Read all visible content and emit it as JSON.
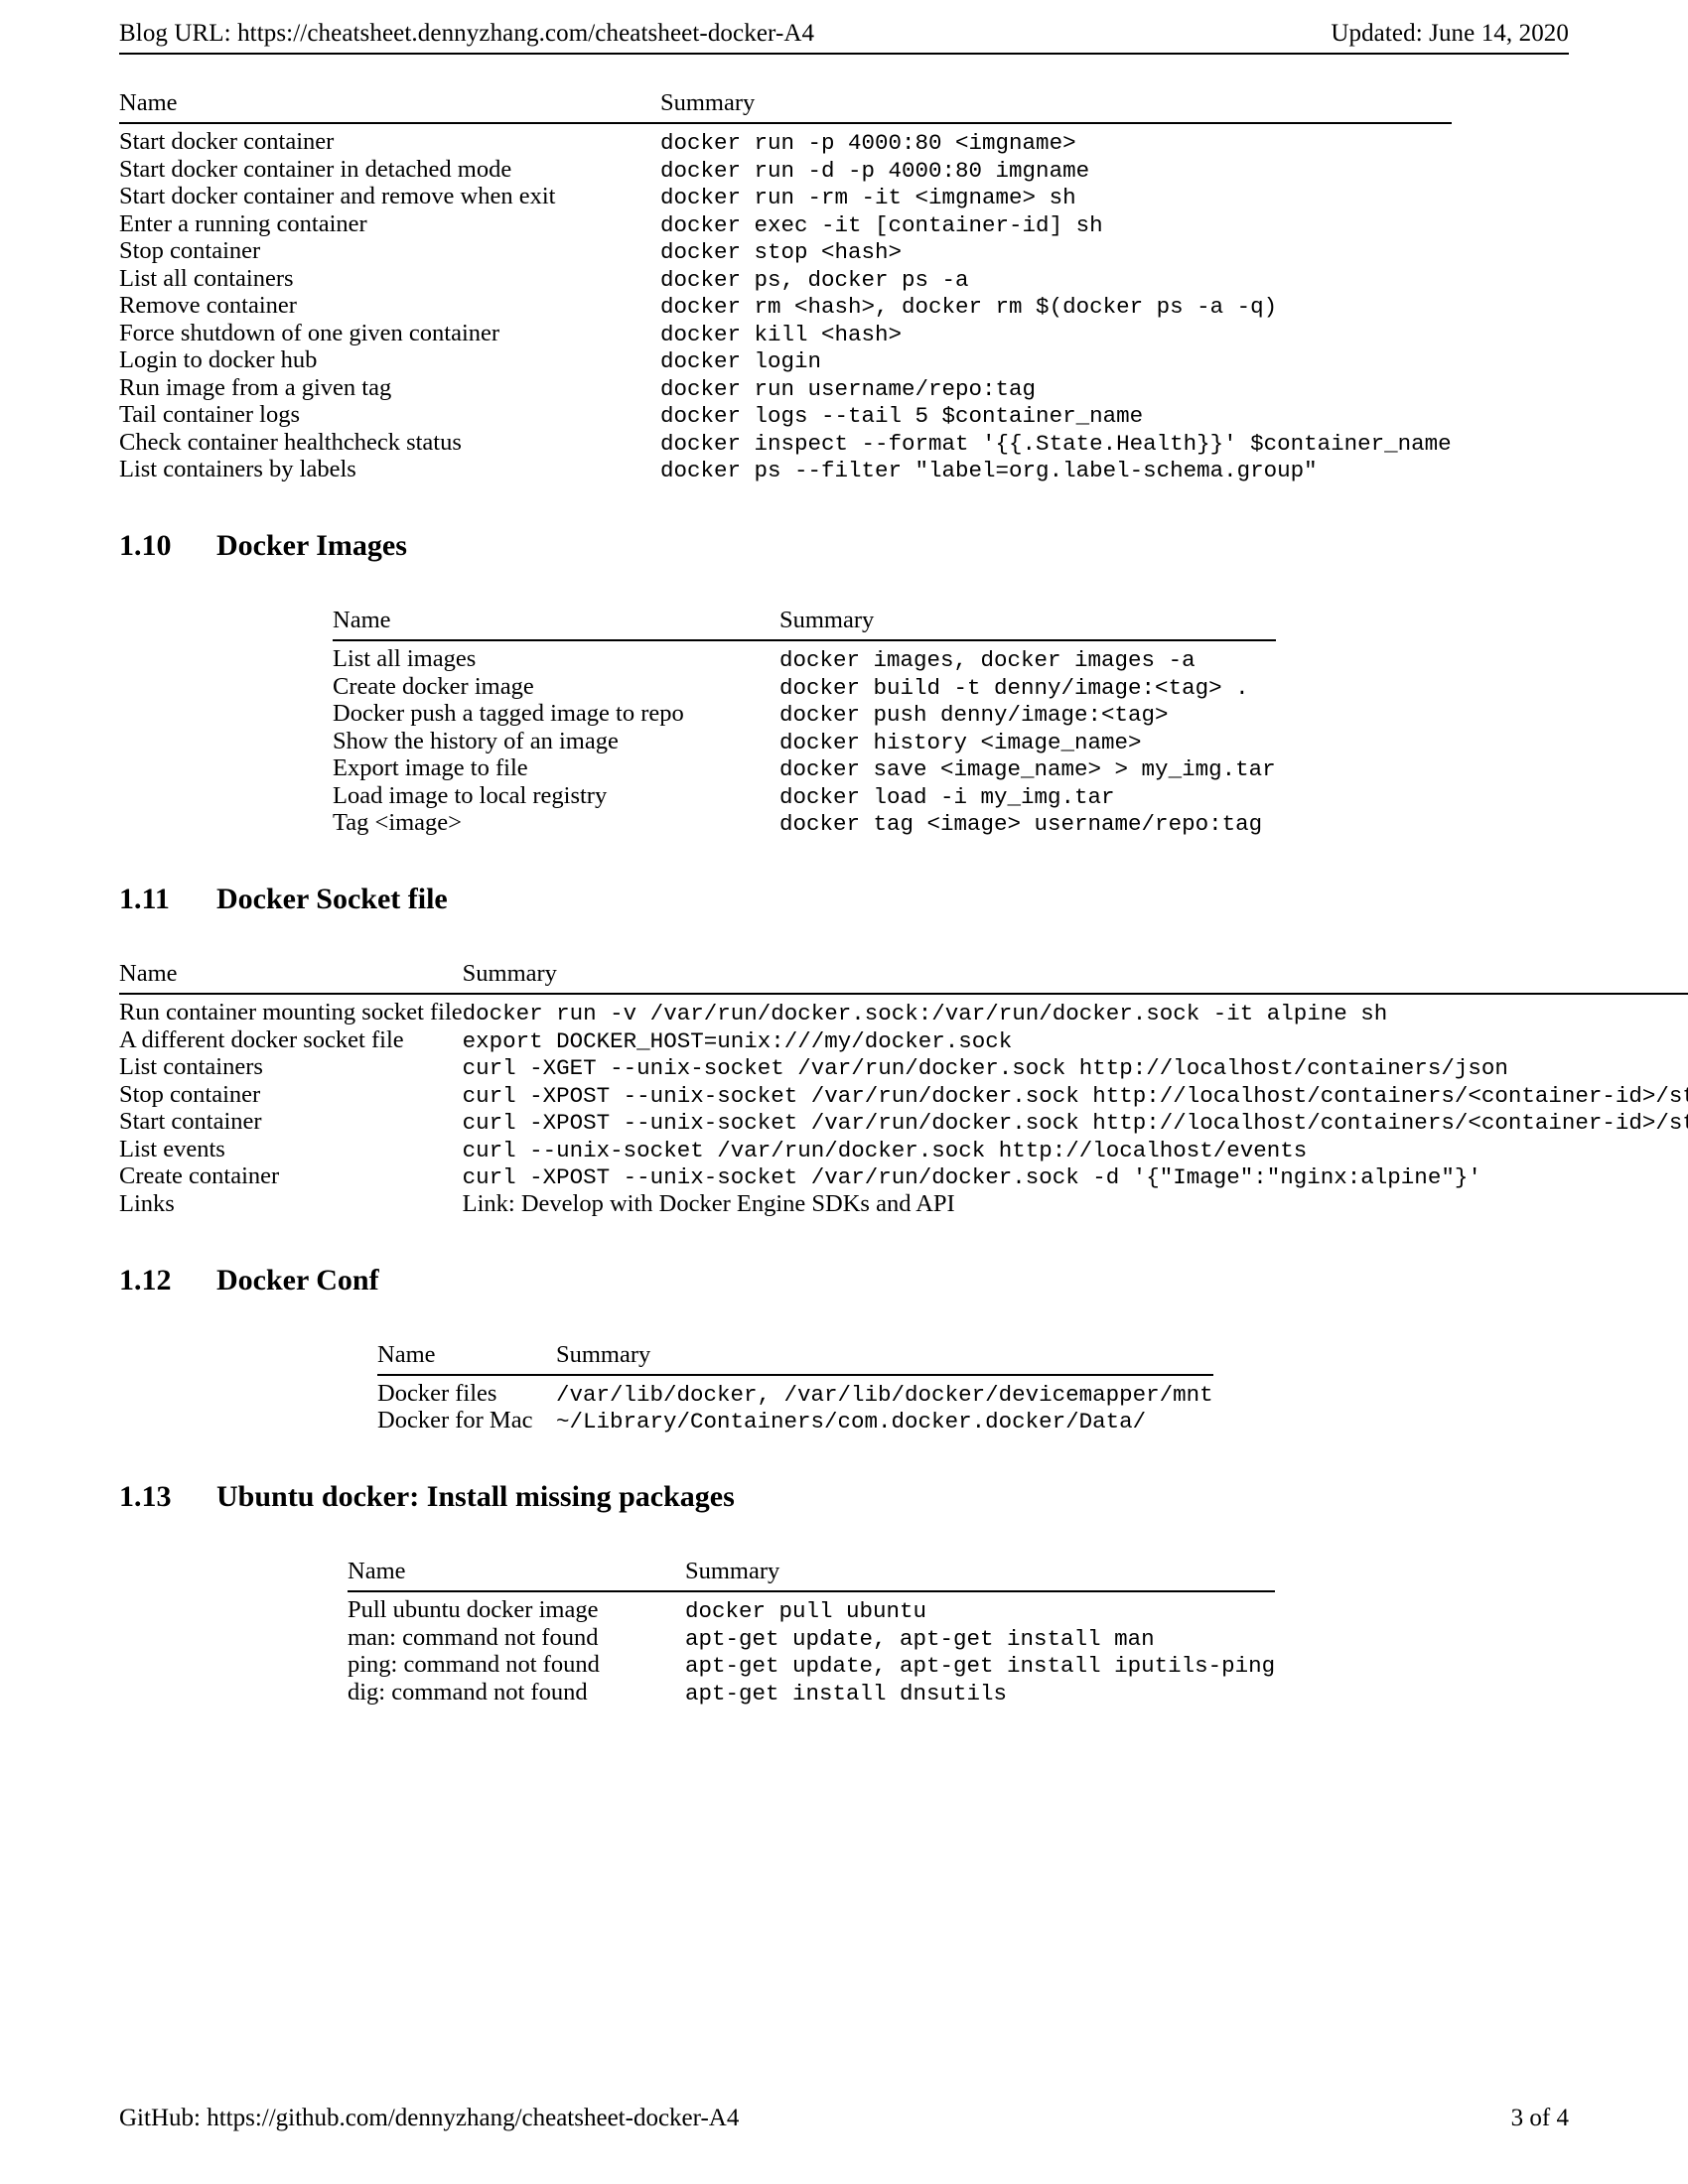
{
  "header": {
    "blog_url_label": "Blog URL: https://cheatsheet.dennyzhang.com/cheatsheet-docker-A4",
    "updated": "Updated: June 14, 2020"
  },
  "footer": {
    "github": "GitHub: https://github.com/dennyzhang/cheatsheet-docker-A4",
    "page": "3 of 4"
  },
  "columns": {
    "name": "Name",
    "summary": "Summary"
  },
  "sections": [
    {
      "number": "",
      "title": "",
      "rows": [
        {
          "name": "Start docker container",
          "summary": "docker run -p 4000:80 <imgname>"
        },
        {
          "name": "Start docker container in detached mode",
          "summary": "docker run -d -p 4000:80 imgname"
        },
        {
          "name": "Start docker container and remove when exit",
          "summary": "docker run -rm -it <imgname> sh"
        },
        {
          "name": "Enter a running container",
          "summary": "docker exec -it [container-id] sh"
        },
        {
          "name": "Stop container",
          "summary": "docker stop <hash>"
        },
        {
          "name": "List all containers",
          "summary": "docker ps, docker ps -a"
        },
        {
          "name": "Remove container",
          "summary": "docker rm <hash>, docker rm $(docker ps -a -q)"
        },
        {
          "name": "Force shutdown of one given container",
          "summary": "docker kill <hash>"
        },
        {
          "name": "Login to docker hub",
          "summary": "docker login"
        },
        {
          "name": "Run image from a given tag",
          "summary": "docker run username/repo:tag"
        },
        {
          "name": "Tail container logs",
          "summary": "docker logs --tail 5 $container_name"
        },
        {
          "name": "Check container healthcheck status",
          "summary": "docker inspect --format '{{.State.Health}}' $container_name"
        },
        {
          "name": "List containers by labels",
          "summary": "docker ps --filter \"label=org.label-schema.group\""
        }
      ]
    },
    {
      "number": "1.10",
      "title": "Docker Images",
      "rows": [
        {
          "name": "List all images",
          "summary": "docker images, docker images -a"
        },
        {
          "name": "Create docker image",
          "summary": "docker build -t denny/image:<tag> ."
        },
        {
          "name": "Docker push a tagged image to repo",
          "summary": "docker push denny/image:<tag>"
        },
        {
          "name": "Show the history of an image",
          "summary": "docker history <image_name>"
        },
        {
          "name": "Export image to file",
          "summary": "docker save <image_name> > my_img.tar"
        },
        {
          "name": "Load image to local registry",
          "summary": "docker load -i my_img.tar"
        },
        {
          "name": "Tag <image>",
          "summary": "docker tag <image> username/repo:tag"
        }
      ]
    },
    {
      "number": "1.11",
      "title": "Docker Socket file",
      "rows": [
        {
          "name": "Run container mounting socket file",
          "summary": "docker run -v /var/run/docker.sock:/var/run/docker.sock -it alpine sh"
        },
        {
          "name": "A different docker socket file",
          "summary": "export DOCKER_HOST=unix:///my/docker.sock"
        },
        {
          "name": "List containers",
          "summary": "curl -XGET --unix-socket /var/run/docker.sock http://localhost/containers/json"
        },
        {
          "name": "Stop container",
          "summary": "curl -XPOST --unix-socket /var/run/docker.sock http://localhost/containers/<container-id>/stop"
        },
        {
          "name": "Start container",
          "summary": "curl -XPOST --unix-socket /var/run/docker.sock http://localhost/containers/<container-id>/start"
        },
        {
          "name": "List events",
          "summary": "curl --unix-socket /var/run/docker.sock http://localhost/events"
        },
        {
          "name": "Create container",
          "summary": "curl -XPOST --unix-socket /var/run/docker.sock -d '{\"Image\":\"nginx:alpine\"}'"
        },
        {
          "name": "Links",
          "summary": "Link: Develop with Docker Engine SDKs and API",
          "serif": true
        }
      ]
    },
    {
      "number": "1.12",
      "title": "Docker Conf",
      "rows": [
        {
          "name": "Docker files",
          "summary": "/var/lib/docker, /var/lib/docker/devicemapper/mnt"
        },
        {
          "name": "Docker for Mac",
          "summary": "~/Library/Containers/com.docker.docker/Data/"
        }
      ]
    },
    {
      "number": "1.13",
      "title": "Ubuntu docker: Install missing packages",
      "rows": [
        {
          "name": "Pull ubuntu docker image",
          "summary": "docker pull ubuntu"
        },
        {
          "name": "man: command not found",
          "summary": "apt-get update, apt-get install man"
        },
        {
          "name": "ping: command not found",
          "summary": "apt-get update, apt-get install iputils-ping"
        },
        {
          "name": "dig: command not found",
          "summary": "apt-get install dnsutils"
        }
      ]
    }
  ]
}
